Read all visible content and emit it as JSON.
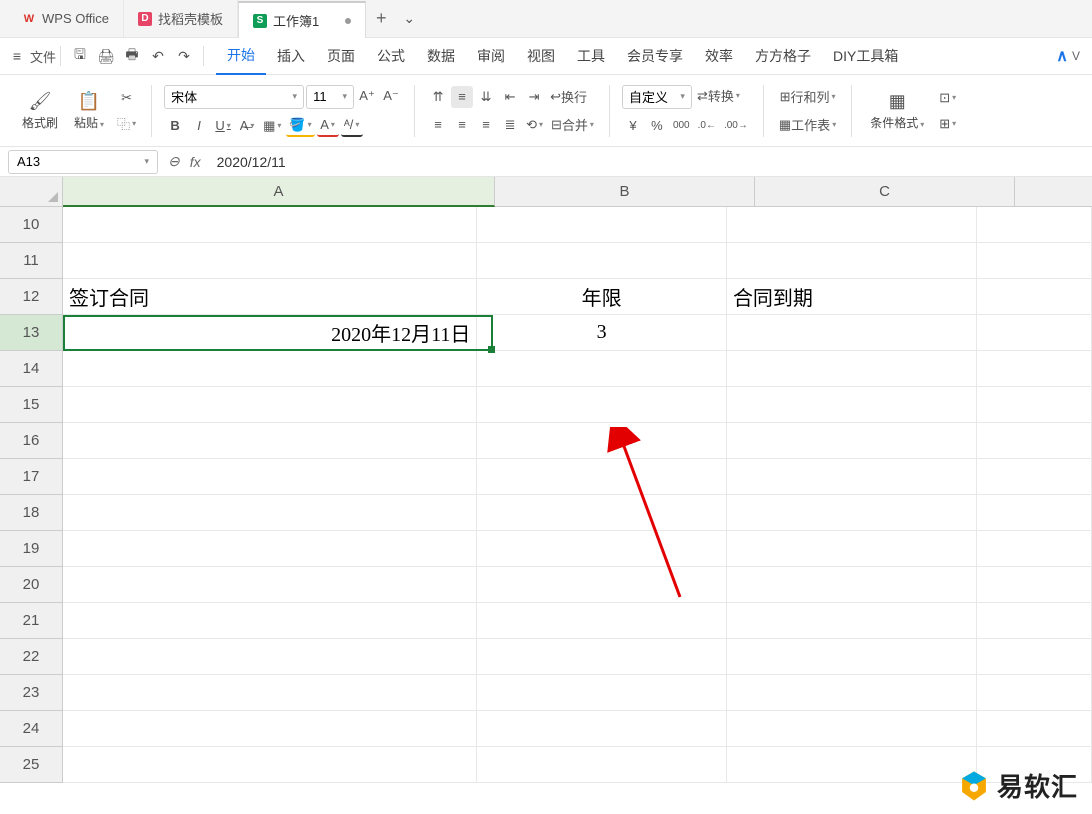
{
  "title_bar": {
    "app_tab": "WPS Office",
    "docer_tab": "找稻壳模板",
    "workbook_tab": "工作簿1",
    "add_btn": "+",
    "list_btn": "⌄"
  },
  "menu_bar": {
    "hamburger": "≡",
    "file": "文件",
    "items": [
      "开始",
      "插入",
      "页面",
      "公式",
      "数据",
      "审阅",
      "视图",
      "工具",
      "会员专享",
      "效率",
      "方方格子",
      "DIY工具箱"
    ],
    "active_index": 0,
    "right_logo": "V"
  },
  "ribbon": {
    "format_painter": "格式刷",
    "paste": "粘贴",
    "font_name": "宋体",
    "font_size": "11",
    "bold": "B",
    "italic": "I",
    "underline": "U",
    "text_a": "A",
    "wrap": "换行",
    "merge": "合并",
    "custom": "自定义",
    "convert": "转换",
    "currency": "¥",
    "percent": "%",
    "thousands": "000",
    "dec_inc": ".0←",
    "dec_dec": ".00→",
    "rows_cols": "行和列",
    "worksheet": "工作表",
    "cond_format": "条件格式",
    "toolbox": "⊞"
  },
  "formula_bar": {
    "name_box": "A13",
    "cancel": "×",
    "fx": "fx",
    "formula": "2020/12/11"
  },
  "grid": {
    "columns": [
      "A",
      "B",
      "C"
    ],
    "rows_start": 10,
    "rows_end": 25,
    "selected_row": 13,
    "cells": {
      "A12": "签订合同",
      "B12": "年限",
      "C12": "合同到期",
      "A13": "2020年12月11日",
      "B13": "3"
    },
    "active_cell": "A13"
  },
  "watermark": "易软汇"
}
